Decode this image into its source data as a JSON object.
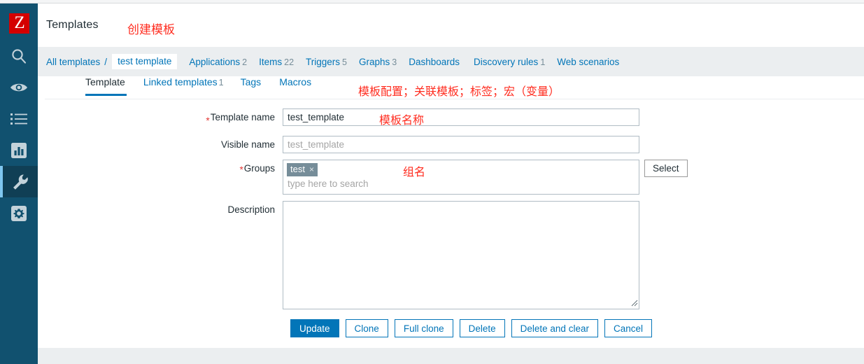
{
  "sidebar": {
    "logo_text": "Z",
    "items": [
      {
        "icon": "search-icon",
        "name": "search"
      },
      {
        "icon": "eye-icon",
        "name": "monitoring"
      },
      {
        "icon": "list-icon",
        "name": "inventory"
      },
      {
        "icon": "chart-bar-icon",
        "name": "reports"
      },
      {
        "icon": "wrench-icon",
        "name": "configuration",
        "active": true
      },
      {
        "icon": "gear-icon",
        "name": "administration"
      }
    ]
  },
  "header": {
    "title": "Templates",
    "annotation": "创建模板"
  },
  "subnav": {
    "breadcrumb_root": "All templates",
    "breadcrumb_sep": "/",
    "breadcrumb_current": "test  template",
    "links": [
      {
        "label": "Applications",
        "count": "2"
      },
      {
        "label": "Items",
        "count": "22"
      },
      {
        "label": "Triggers",
        "count": "5"
      },
      {
        "label": "Graphs",
        "count": "3"
      },
      {
        "label": "Dashboards",
        "count": ""
      },
      {
        "label": "Discovery rules",
        "count": "1"
      },
      {
        "label": "Web scenarios",
        "count": ""
      }
    ]
  },
  "tabs": {
    "items": [
      {
        "label": "Template",
        "count": "",
        "active": true
      },
      {
        "label": "Linked templates",
        "count": "1",
        "active": false
      },
      {
        "label": "Tags",
        "count": "",
        "active": false
      },
      {
        "label": "Macros",
        "count": "",
        "active": false
      }
    ],
    "annotation": "模板配置；关联模板；标签；宏（变量）"
  },
  "form": {
    "template_name": {
      "label": "Template name",
      "required": "*",
      "value": "test_template",
      "annotation": "模板名称"
    },
    "visible_name": {
      "label": "Visible name",
      "required": "",
      "value": "",
      "placeholder": "test_template"
    },
    "groups": {
      "label": "Groups",
      "required": "*",
      "chip": "test",
      "chip_remove": "×",
      "search_placeholder": "type here to search",
      "select_button": "Select",
      "annotation": "组名"
    },
    "description": {
      "label": "Description",
      "required": "",
      "value": ""
    }
  },
  "buttons": [
    {
      "label": "Update",
      "primary": true
    },
    {
      "label": "Clone",
      "primary": false
    },
    {
      "label": "Full clone",
      "primary": false
    },
    {
      "label": "Delete",
      "primary": false
    },
    {
      "label": "Delete and clear",
      "primary": false
    },
    {
      "label": "Cancel",
      "primary": false
    }
  ],
  "colors": {
    "sidebar_bg": "#11516f",
    "logo_bg": "#d40000",
    "accent_blue": "#0275b8",
    "subnav_bg": "#ebeef0",
    "annotation_red": "#ff2d20",
    "chip_bg": "#768d99",
    "required_red": "#e33734"
  }
}
